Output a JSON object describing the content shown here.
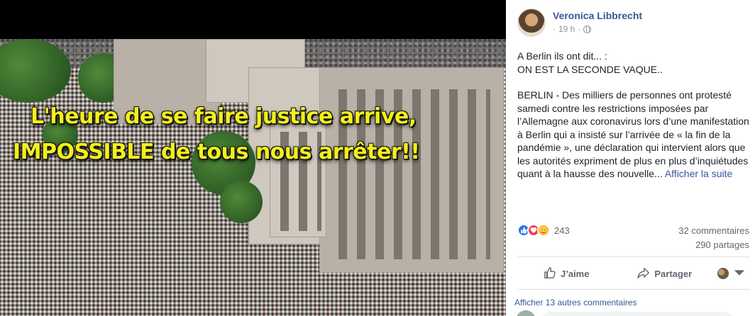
{
  "image": {
    "overlay_line1": "L'heure de se faire justice arrive,",
    "overlay_line2": "IMPOSSIBLE de tous nous arrêter!!"
  },
  "post": {
    "author": "Veronica Libbrecht",
    "time": "19 h",
    "meta_separator": "·",
    "paragraph1_line1": "A Berlin ils ont dit... :",
    "paragraph1_line2": "ON EST LA SECONDE VAQUE..",
    "paragraph2": "BERLIN - Des milliers de personnes ont protesté samedi contre les restrictions imposées par l’Allemagne aux coronavirus lors d’une manifestation à Berlin qui a insisté sur l’arrivée de « la fin de la pandémie », une déclaration qui intervient alors que les autorités expriment de plus en plus d’inquiétudes quant à la hausse des nouvelle...",
    "see_more": "Afficher la suite"
  },
  "stats": {
    "reactions_count": "243",
    "comments": "32 commentaires",
    "shares": "290 partages"
  },
  "actions": {
    "like": "J’aime",
    "share": "Partager"
  },
  "comments": {
    "more": "Afficher 13 autres commentaires"
  },
  "icons": {
    "privacy": "globe-icon",
    "like": "thumbs-up-icon",
    "share": "share-arrow-icon",
    "dropdown": "caret-down-icon"
  },
  "colors": {
    "link": "#385898",
    "overlay_text": "#f2ef1c",
    "like_reaction": "#2078f4",
    "love_reaction": "#f33e58"
  }
}
